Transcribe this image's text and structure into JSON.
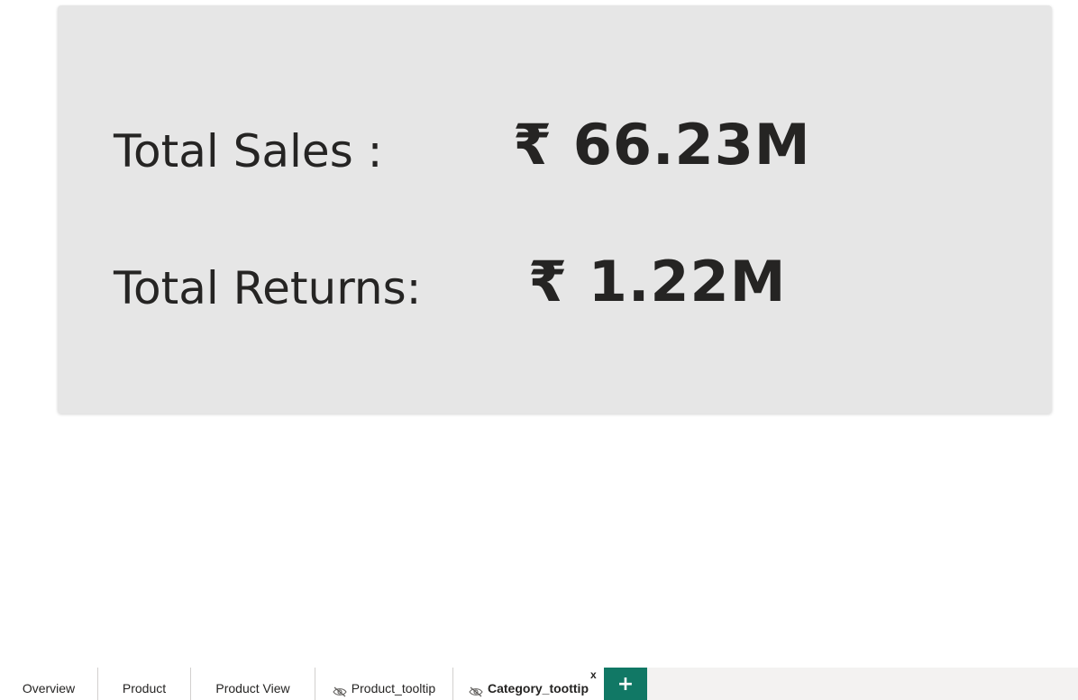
{
  "card": {
    "sales_label": "Total Sales :",
    "sales_value": "₹ 66.23M",
    "returns_label": "Total Returns:",
    "returns_value": "₹ 1.22M"
  },
  "tabs": [
    {
      "label": "Overview",
      "hidden": false,
      "active": false
    },
    {
      "label": "Product",
      "hidden": false,
      "active": false
    },
    {
      "label": "Product View",
      "hidden": false,
      "active": false
    },
    {
      "label": "Product_tooltip",
      "hidden": true,
      "active": false
    },
    {
      "label": "Category_toottip",
      "hidden": true,
      "active": true
    }
  ],
  "close_label": "x",
  "add_page_label": "+",
  "colors": {
    "card_bg": "#e6e6e6",
    "text": "#252423",
    "add_button": "#117865",
    "tabbar_bg": "#f3f2f1"
  },
  "icons": {
    "hidden_page": "eye-slash-icon",
    "add_page": "plus-icon",
    "close": "close-icon"
  }
}
